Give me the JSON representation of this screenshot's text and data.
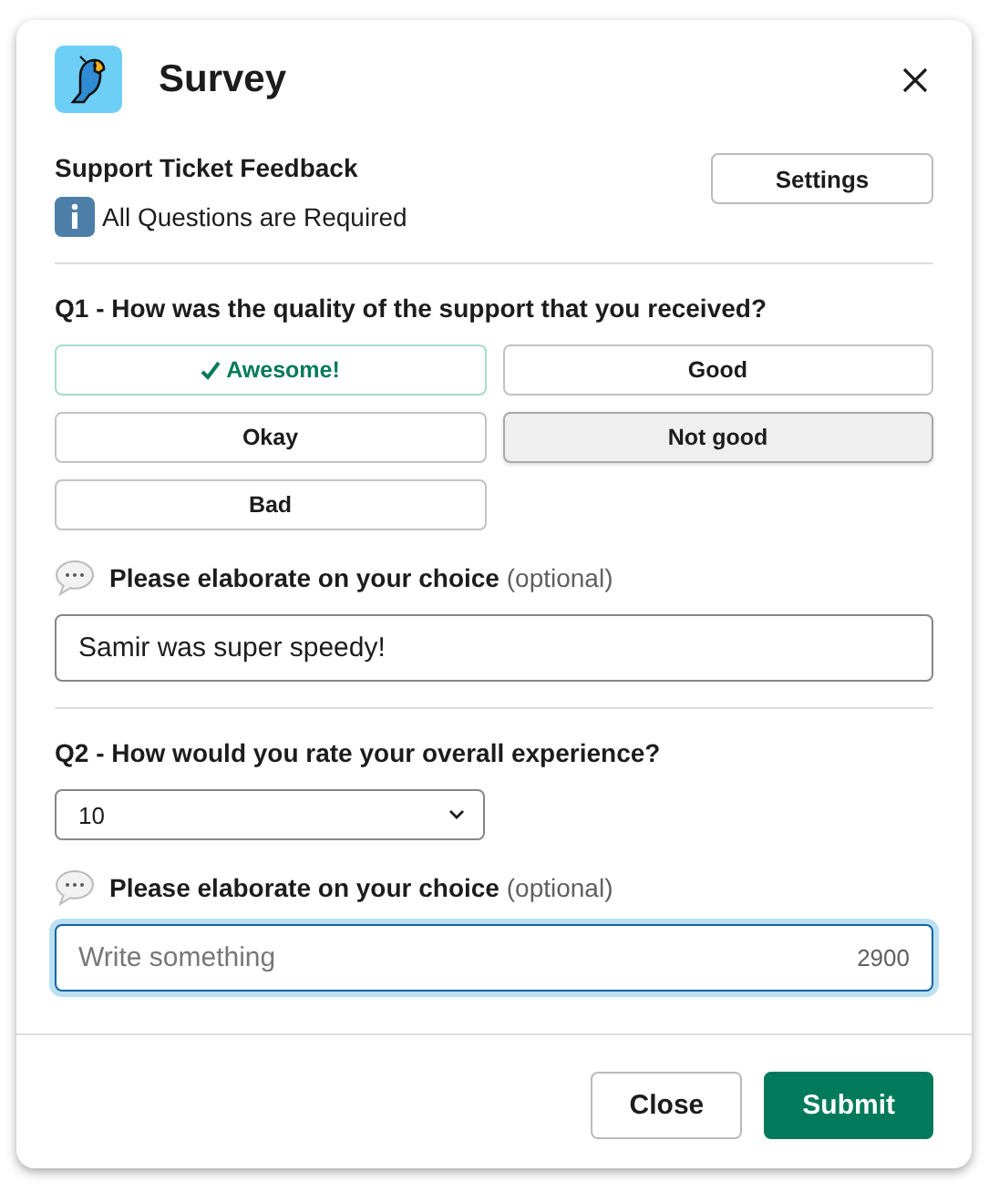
{
  "window": {
    "title": "Survey"
  },
  "survey": {
    "name": "Support Ticket Feedback",
    "settings_button": "Settings",
    "notice": "All Questions are Required"
  },
  "questions": [
    {
      "kind": "buttons",
      "title": "Q1 - How was the quality of the support that you received?",
      "options": [
        {
          "label": "Awesome!",
          "selected": true,
          "hovered": false
        },
        {
          "label": "Good",
          "selected": false,
          "hovered": false
        },
        {
          "label": "Okay",
          "selected": false,
          "hovered": false
        },
        {
          "label": "Not good",
          "selected": false,
          "hovered": true
        },
        {
          "label": "Bad",
          "selected": false,
          "hovered": false
        }
      ],
      "comment": {
        "label": "Please elaborate on your choice",
        "hint": "(optional)",
        "value": "Samir was super speedy!",
        "focused": false
      }
    },
    {
      "kind": "select",
      "title": "Q2 - How would you rate your overall experience?",
      "value": "10",
      "comment": {
        "label": "Please elaborate on your choice",
        "hint": "(optional)",
        "placeholder": "Write something",
        "counter": "2900",
        "focused": true
      }
    }
  ],
  "buttons": [
    {
      "label": "Close",
      "kind": "secondary"
    },
    {
      "label": "Submit",
      "kind": "primary"
    }
  ]
}
